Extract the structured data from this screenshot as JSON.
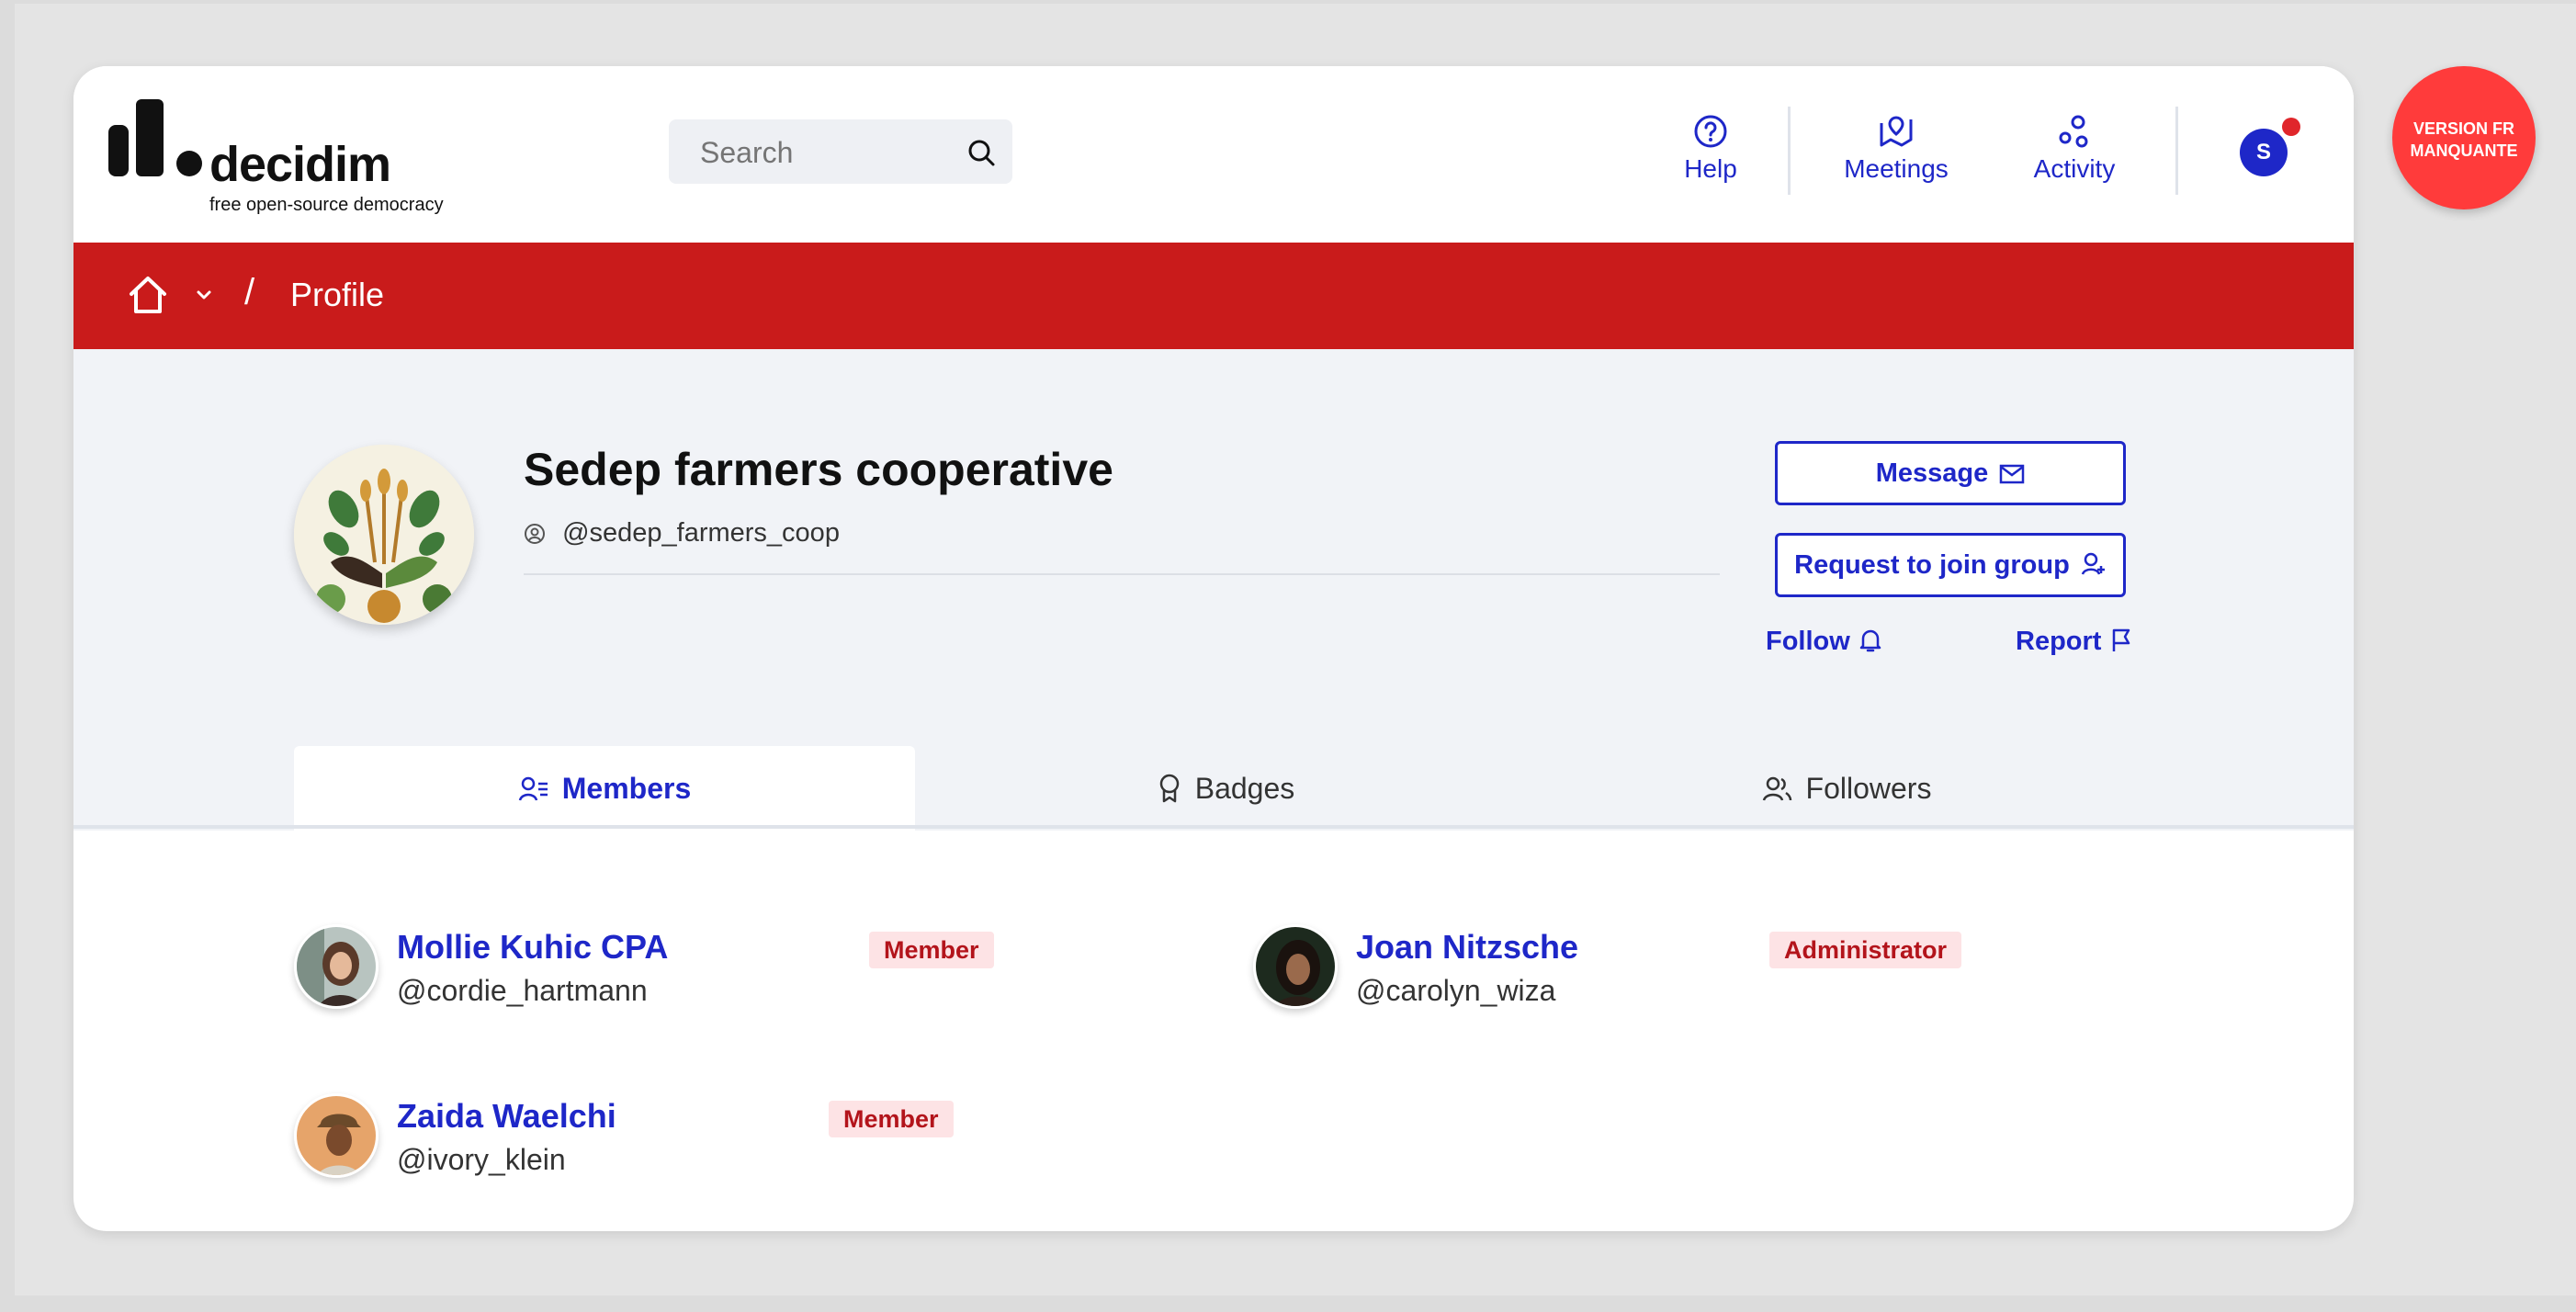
{
  "header": {
    "logo_word": "decidim",
    "logo_tagline": "free open-source democracy",
    "search_placeholder": "Search",
    "nav": [
      {
        "label": "Help",
        "icon": "help-icon"
      },
      {
        "label": "Meetings",
        "icon": "meetings-icon"
      },
      {
        "label": "Activity",
        "icon": "activity-icon"
      }
    ],
    "user_initial": "S"
  },
  "breadcrumb": {
    "current": "Profile",
    "separator": "/"
  },
  "profile": {
    "name": "Sedep farmers cooperative",
    "handle": "@sedep_farmers_coop",
    "message_label": "Message",
    "join_label": "Request to join group",
    "follow_label": "Follow",
    "report_label": "Report"
  },
  "tabs": [
    {
      "label": "Members",
      "active": true
    },
    {
      "label": "Badges",
      "active": false
    },
    {
      "label": "Followers",
      "active": false
    }
  ],
  "members": [
    {
      "name": "Mollie Kuhic CPA",
      "role": "Member",
      "handle": "@cordie_hartmann"
    },
    {
      "name": "Joan Nitzsche",
      "role": "Administrator",
      "handle": "@carolyn_wiza"
    },
    {
      "name": "Zaida Waelchi",
      "role": "Member",
      "handle": "@ivory_klein"
    }
  ],
  "corner_badge": {
    "line1": "VERSION FR",
    "line2": "MANQUANTE"
  },
  "colors": {
    "primary": "#1e27c8",
    "brand_red": "#c91b1b",
    "badge_red": "#ff3b3b"
  }
}
